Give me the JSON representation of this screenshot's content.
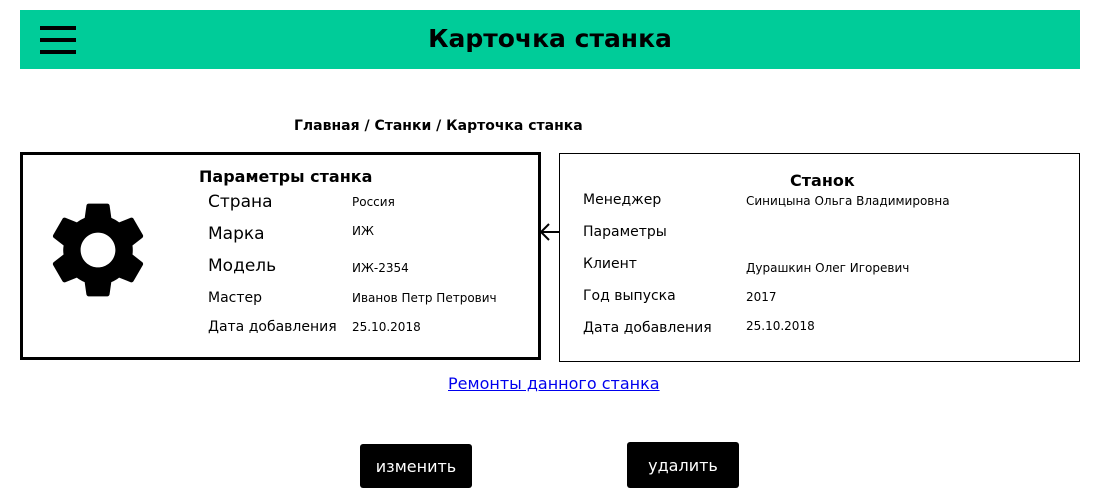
{
  "header": {
    "menu_icon": "hamburger-menu-icon",
    "title": "Карточка станка",
    "color": "#00cc99"
  },
  "breadcrumb": {
    "home": "Главная",
    "separator": " / ",
    "machines": "Станки",
    "current": "Карточка станка"
  },
  "params_card": {
    "title": "Параметры станка",
    "icon": "gear-icon",
    "fields": [
      {
        "label": "Страна",
        "value": "Россия"
      },
      {
        "label": "Марка",
        "value": "ИЖ"
      },
      {
        "label": "Модель",
        "value": "ИЖ-2354"
      },
      {
        "label": "Мастер",
        "value": "Иванов Петр Петрович"
      },
      {
        "label": "Дата добавления",
        "value": "25.10.2018"
      }
    ]
  },
  "machine_card": {
    "title": "Станок",
    "fields": [
      {
        "label": "Менеджер",
        "value": "Синицына Ольга Владимировна"
      },
      {
        "label": "Параметры",
        "value": ""
      },
      {
        "label": "Клиент",
        "value": "Дурашкин Олег Игоревич"
      },
      {
        "label": "Год выпуска",
        "value": "2017"
      },
      {
        "label": "Дата добавления",
        "value": "25.10.2018"
      }
    ]
  },
  "link": {
    "repairs": "Ремонты данного станка"
  },
  "actions": {
    "edit": "изменить",
    "delete": "удалить"
  }
}
